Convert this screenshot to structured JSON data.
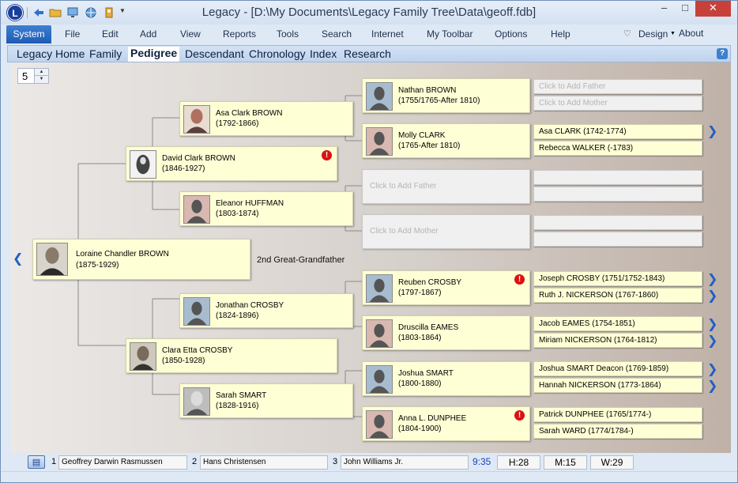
{
  "window": {
    "title": "Legacy - [D:\\My Documents\\Legacy Family Tree\\Data\\geoff.fdb]",
    "min_label": "–",
    "max_label": "□",
    "close_label": "✕"
  },
  "app": {
    "logo_letter": "L"
  },
  "ribbon": {
    "system": "System",
    "tabs": [
      "File",
      "Edit",
      "Add",
      "View",
      "Reports",
      "Tools",
      "Search",
      "Internet",
      "My Toolbar",
      "Options",
      "Help"
    ],
    "design": "Design",
    "about": "About"
  },
  "viewtabs": {
    "items": [
      "Legacy Home",
      "Family",
      "Pedigree",
      "Descendant",
      "Chronology",
      "Index",
      "Research"
    ],
    "active": "Pedigree",
    "help": "?"
  },
  "pedigree": {
    "generations": "5",
    "generation_label": "2nd Great-Grandfather",
    "root": {
      "name": "Loraine Chandler BROWN",
      "dates": "(1875-1929)"
    },
    "parents": [
      {
        "name": "David Clark BROWN",
        "dates": "(1846-1927)",
        "warning": true
      },
      {
        "name": "Clara Etta CROSBY",
        "dates": "(1850-1928)",
        "warning": false
      }
    ],
    "grandparents": [
      {
        "name": "Asa Clark BROWN",
        "dates": "(1792-1866)"
      },
      {
        "name": "Eleanor HUFFMAN",
        "dates": "(1803-1874)"
      },
      {
        "name": "Jonathan CROSBY",
        "dates": "(1824-1896)"
      },
      {
        "name": "Sarah SMART",
        "dates": "(1828-1916)"
      }
    ],
    "great_grandparents": [
      {
        "name": "Nathan BROWN",
        "dates": "(1755/1765-After 1810)",
        "warning": false
      },
      {
        "name": "Molly CLARK",
        "dates": "(1765-After 1810)",
        "warning": false
      },
      {
        "name": "",
        "dates": "",
        "placeholder": "Click to Add Father"
      },
      {
        "name": "",
        "dates": "",
        "placeholder": "Click to Add Mother"
      },
      {
        "name": "Reuben CROSBY",
        "dates": "(1797-1867)",
        "warning": true
      },
      {
        "name": "Druscilla EAMES",
        "dates": "(1803-1864)",
        "warning": false
      },
      {
        "name": "Joshua SMART",
        "dates": "(1800-1880)",
        "warning": false
      },
      {
        "name": "Anna L. DUNPHEE",
        "dates": "(1804-1900)",
        "warning": true
      }
    ],
    "gen5": [
      {
        "text": "Click to Add Father",
        "empty": true
      },
      {
        "text": "Click to Add Mother",
        "empty": true
      },
      {
        "text": "Asa CLARK (1742-1774)",
        "empty": false
      },
      {
        "text": "Rebecca WALKER (-1783)",
        "empty": false
      },
      {
        "text": "",
        "empty": true
      },
      {
        "text": "",
        "empty": true
      },
      {
        "text": "",
        "empty": true
      },
      {
        "text": "",
        "empty": true
      },
      {
        "text": "Joseph CROSBY (1751/1752-1843)",
        "empty": false
      },
      {
        "text": "Ruth J. NICKERSON (1767-1860)",
        "empty": false
      },
      {
        "text": "Jacob EAMES (1754-1851)",
        "empty": false
      },
      {
        "text": "Miriam NICKERSON (1764-1812)",
        "empty": false
      },
      {
        "text": "Joshua SMART Deacon (1769-1859)",
        "empty": false
      },
      {
        "text": "Hannah NICKERSON (1773-1864)",
        "empty": false
      },
      {
        "text": "Patrick DUNPHEE (1765/1774-)",
        "empty": false
      },
      {
        "text": "Sarah WARD (1774/1784-)",
        "empty": false
      }
    ],
    "warning_symbol": "!",
    "chevron_right": "❯",
    "chevron_left": "❮"
  },
  "statusbar": {
    "slots": [
      {
        "num": "1",
        "name": "Geoffrey Darwin Rasmussen"
      },
      {
        "num": "2",
        "name": "Hans Christensen"
      },
      {
        "num": "3",
        "name": "John Williams Jr."
      }
    ],
    "time": "9:35",
    "h": "H:28",
    "m": "M:15",
    "w": "W:29"
  },
  "colors": {
    "card": "#ffffd6",
    "accent": "#1f5fc5",
    "warning": "#dd1111"
  },
  "icons": [
    "back-icon",
    "open-folder-icon",
    "monitor-icon",
    "globe-icon",
    "key-icon",
    "heart-icon",
    "help-icon",
    "book-icon"
  ]
}
